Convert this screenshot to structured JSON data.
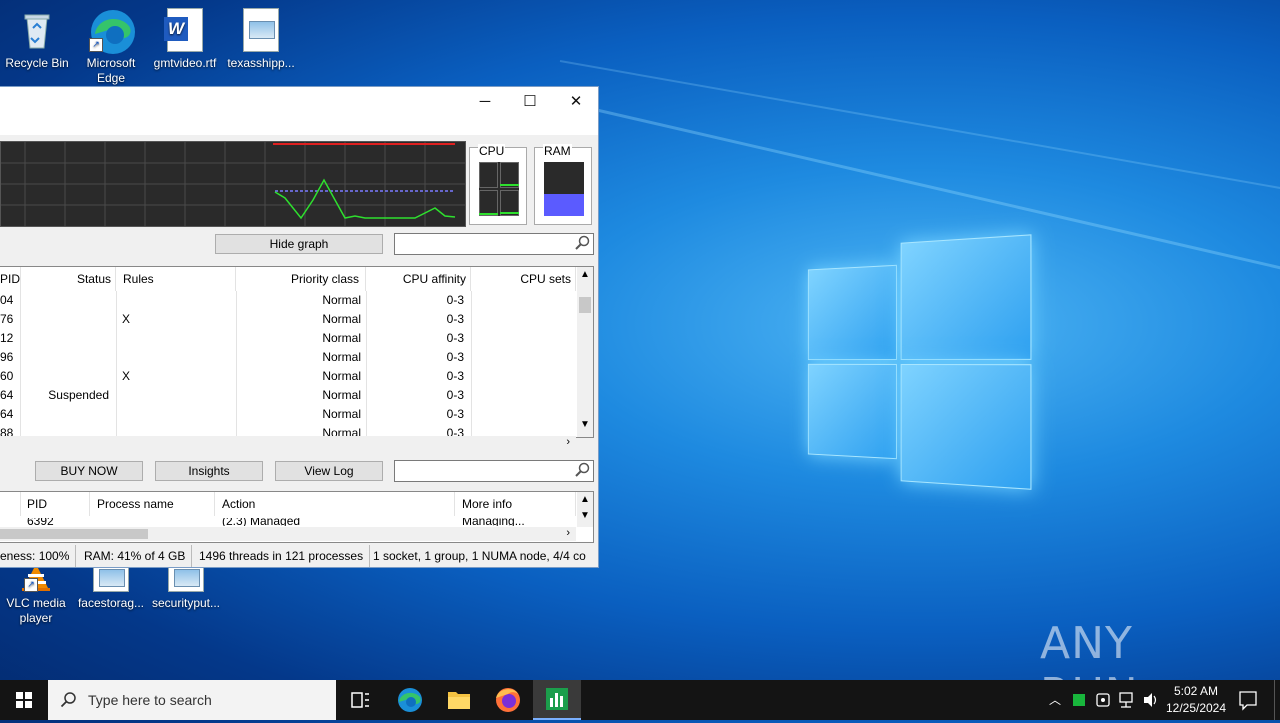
{
  "desktop": {
    "icons_top": [
      {
        "label": "Recycle Bin",
        "icon": "recycle-bin-icon"
      },
      {
        "label": "Microsoft Edge",
        "icon": "edge-icon"
      },
      {
        "label": "gmtvideo.rtf",
        "icon": "word-document-icon"
      },
      {
        "label": "texasshipp...",
        "icon": "image-file-icon"
      }
    ],
    "icons_bottom": [
      {
        "label": "VLC media player",
        "icon": "vlc-icon"
      },
      {
        "label": "facestorag...",
        "icon": "image-file-icon"
      },
      {
        "label": "securityput...",
        "icon": "image-file-icon"
      }
    ],
    "watermark": "ANY RUN"
  },
  "window": {
    "controls": {
      "minimize": "─",
      "maximize": "☐",
      "close": "✕"
    },
    "meters": {
      "cpu_label": "CPU",
      "ram_label": "RAM",
      "ram_level": 0.41
    },
    "hide_graph_label": "Hide graph",
    "process_search_placeholder": "",
    "columns": [
      "PID",
      "Status",
      "Rules",
      "Priority class",
      "CPU affinity",
      "CPU sets"
    ],
    "rows": [
      {
        "pid": "04",
        "status": "",
        "rules": "",
        "priority": "Normal",
        "affinity": "0-3"
      },
      {
        "pid": "76",
        "status": "",
        "rules": "X",
        "priority": "Normal",
        "affinity": "0-3"
      },
      {
        "pid": "12",
        "status": "",
        "rules": "",
        "priority": "Normal",
        "affinity": "0-3"
      },
      {
        "pid": "96",
        "status": "",
        "rules": "",
        "priority": "Normal",
        "affinity": "0-3"
      },
      {
        "pid": "60",
        "status": "",
        "rules": "X",
        "priority": "Normal",
        "affinity": "0-3"
      },
      {
        "pid": "64",
        "status": "Suspended",
        "rules": "",
        "priority": "Normal",
        "affinity": "0-3"
      },
      {
        "pid": "64",
        "status": "",
        "rules": "",
        "priority": "Normal",
        "affinity": "0-3"
      },
      {
        "pid": "88",
        "status": "",
        "rules": "",
        "priority": "Normal",
        "affinity": "0-3"
      }
    ],
    "buttons": {
      "buy_now": "BUY NOW",
      "insights": "Insights",
      "view_log": "View Log"
    },
    "log_search_placeholder": "",
    "log_columns": [
      "PID",
      "Process name",
      "Action",
      "More info"
    ],
    "log_partial_row": {
      "pid": "6392",
      "action": "(2.3) Managed",
      "more_info": "Managing..."
    },
    "status": {
      "responsiveness": "eness: 100%",
      "ram": "RAM: 41% of 4 GB",
      "threads": "1496 threads in 121 processes",
      "topology": "1 socket, 1 group, 1 NUMA node, 4/4 co"
    }
  },
  "taskbar": {
    "search_placeholder": "Type here to search",
    "apps": [
      "task-view-icon",
      "edge-icon",
      "file-explorer-icon",
      "firefox-icon",
      "process-lasso-icon"
    ],
    "clock_time": "5:02 AM",
    "clock_date": "12/25/2024"
  }
}
